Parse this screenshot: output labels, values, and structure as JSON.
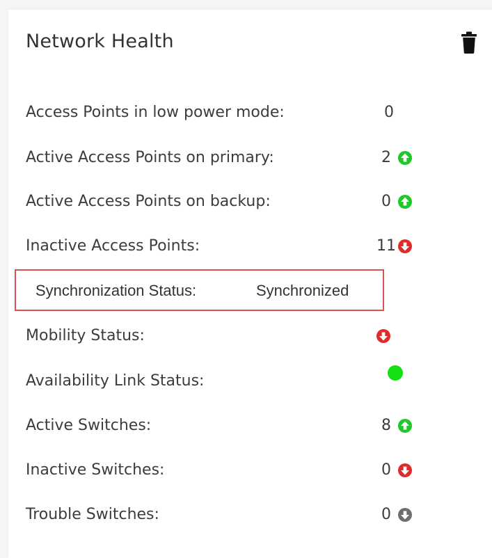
{
  "widget": {
    "title": "Network Health",
    "delete_icon": "trash-icon"
  },
  "colors": {
    "up": "#1ec927",
    "down": "#e02b2b",
    "neutral": "#6e6e6e",
    "highlight_border": "#d9534f",
    "dot_green": "#12e012"
  },
  "rows": [
    {
      "label": "Access Points in low power mode:",
      "value": "0",
      "indicator": "none"
    },
    {
      "label": "Active Access Points on primary:",
      "value": "2",
      "indicator": "up-arrow-icon"
    },
    {
      "label": "Active Access Points on backup:",
      "value": "0",
      "indicator": "up-arrow-icon"
    },
    {
      "label": "Inactive Access Points:",
      "value": "11",
      "indicator": "down-arrow-icon"
    },
    {
      "label": "Synchronization Status:",
      "value": "Synchronized",
      "indicator": "none"
    },
    {
      "label": "Mobility Status:",
      "value": "",
      "indicator": "down-arrow-icon"
    },
    {
      "label": "Availability Link Status:",
      "value": "",
      "indicator": "green-dot-icon"
    },
    {
      "label": "Active Switches:",
      "value": "8",
      "indicator": "up-arrow-icon"
    },
    {
      "label": "Inactive Switches:",
      "value": "0",
      "indicator": "down-arrow-icon"
    },
    {
      "label": "Trouble Switches:",
      "value": "0",
      "indicator": "neutral-down-arrow-icon"
    }
  ]
}
